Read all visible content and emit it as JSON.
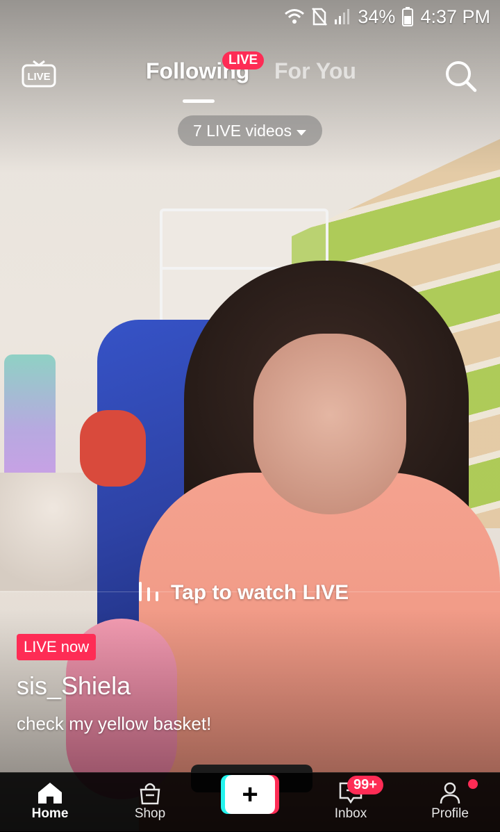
{
  "status_bar": {
    "battery": "34%",
    "time": "4:37 PM",
    "icons": [
      "wifi-icon",
      "no-sim-icon",
      "signal-icon",
      "battery-icon"
    ]
  },
  "top_nav": {
    "live_icon_text": "LIVE",
    "tabs": [
      {
        "label": "Following",
        "active": true
      },
      {
        "label": "For You",
        "active": false
      }
    ],
    "live_badge": "LIVE",
    "search_icon": "search-icon"
  },
  "live_pill": {
    "label": "7 LIVE videos"
  },
  "stream": {
    "cta": "Tap to watch LIVE",
    "live_now": "LIVE now",
    "username": "sis_Shiela",
    "caption": "check my yellow basket!"
  },
  "bottom_nav": {
    "items": [
      {
        "label": "Home",
        "icon": "home-icon",
        "active": true
      },
      {
        "label": "Shop",
        "icon": "shop-bag-icon",
        "active": false
      },
      {
        "label": "Inbox",
        "icon": "inbox-icon",
        "active": false
      },
      {
        "label": "Profile",
        "icon": "profile-icon",
        "active": false
      }
    ],
    "inbox_badge": "99+",
    "create_icon": "plus-icon"
  },
  "colors": {
    "accent": "#fe2c55",
    "create_cyan": "#25f4ee"
  }
}
